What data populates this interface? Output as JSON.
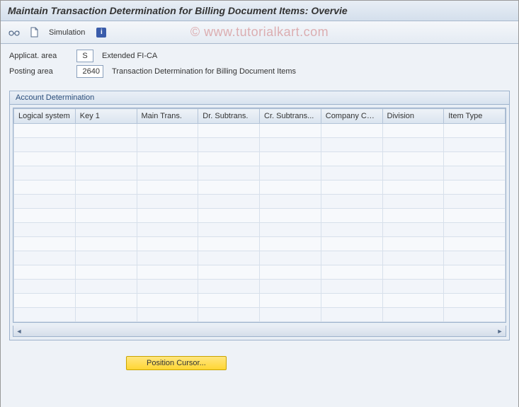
{
  "title": "Maintain Transaction Determination for Billing Document Items: Overvie",
  "toolbar": {
    "simulation_label": "Simulation"
  },
  "fields": {
    "applicat_area": {
      "label": "Applicat. area",
      "value": "S",
      "desc": "Extended FI-CA"
    },
    "posting_area": {
      "label": "Posting area",
      "value": "2640",
      "desc": "Transaction Determination for Billing Document Items"
    }
  },
  "section": {
    "title": "Account Determination",
    "columns": [
      "Logical system",
      "Key 1",
      "Main Trans.",
      "Dr. Subtrans.",
      "Cr. Subtrans...",
      "Company Code",
      "Division",
      "Item Type"
    ],
    "rows": 14
  },
  "footer": {
    "position_cursor_label": "Position Cursor..."
  },
  "watermark": "© www.tutorialkart.com"
}
